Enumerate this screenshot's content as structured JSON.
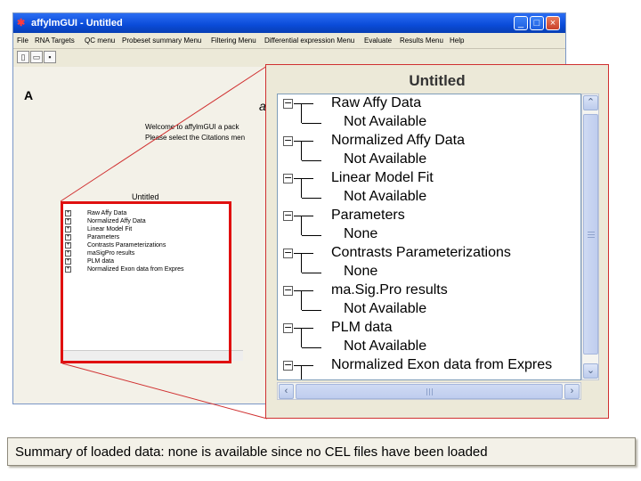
{
  "window": {
    "title": "affylmGUI - Untitled",
    "app_icon": "affylmgui-logo-icon",
    "controls": {
      "minimize": "_",
      "maximize": "□",
      "close": "×"
    }
  },
  "menu": [
    "File",
    "RNA Targets",
    "QC menu",
    "Probeset summary Menu",
    "Filtering Menu",
    "Differential expression Menu",
    "Evaluate",
    "Results Menu",
    "Help"
  ],
  "toolbar": [
    "new-file-icon",
    "open-folder-icon",
    "save-icon"
  ],
  "main": {
    "label": "A",
    "title_partial": "a",
    "welcome_line1": "Welcome to affylmGUI  a pack",
    "welcome_line2": "Please select the Citations men"
  },
  "small_tree": {
    "title": "Untitled",
    "items": [
      "Raw Affy Data",
      "Normalized Affy Data",
      "Linear Model Fit",
      "Parameters",
      "Contrasts Parameterizations",
      "maSigPro results",
      "PLM data",
      "Normalized Exon data from Expres"
    ]
  },
  "zoom_panel": {
    "title": "Untitled",
    "nodes": [
      {
        "label": "Raw Affy Data",
        "child": "Not Available"
      },
      {
        "label": "Normalized Affy Data",
        "child": "Not Available"
      },
      {
        "label": "Linear Model Fit",
        "child": "Not Available"
      },
      {
        "label": "Parameters",
        "child": "None"
      },
      {
        "label": "Contrasts Parameterizations",
        "child": "None"
      },
      {
        "label": "ma.Sig.Pro results",
        "child": "Not Available"
      },
      {
        "label": "PLM data",
        "child": "Not Available"
      },
      {
        "label": "Normalized Exon data from Expres",
        "child": ""
      }
    ],
    "expander_symbol": "−"
  },
  "caption": "Summary of loaded data: none is available since no CEL files have been loaded",
  "colors": {
    "titlebar": "#0a4bd8",
    "highlight": "#e01010",
    "connector": "#d03030"
  }
}
